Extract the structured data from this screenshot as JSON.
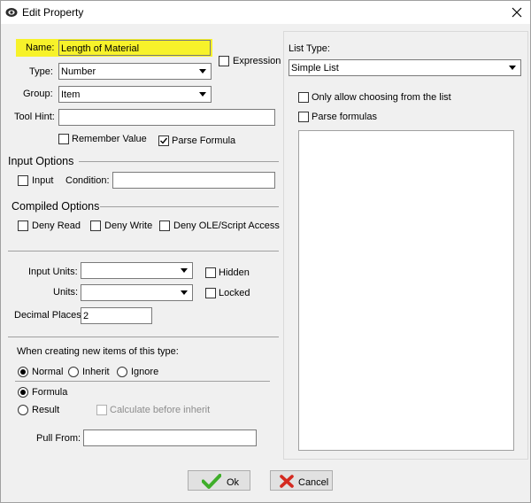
{
  "window": {
    "title": "Edit Property"
  },
  "name": {
    "label": "Name:",
    "value": "Length of Material"
  },
  "expression": {
    "label": "Expression",
    "checked": false
  },
  "type": {
    "label": "Type:",
    "value": "Number"
  },
  "group": {
    "label": "Group:",
    "value": "Item"
  },
  "tool_hint": {
    "label": "Tool Hint:",
    "value": ""
  },
  "remember_value": {
    "label": "Remember Value",
    "checked": false
  },
  "parse_formula": {
    "label": "Parse Formula",
    "checked": true
  },
  "input_options": {
    "title": "Input Options",
    "input_label": "Input",
    "condition_label": "Condition:",
    "condition_value": ""
  },
  "compiled_options": {
    "title": "Compiled Options",
    "deny_read": "Deny Read",
    "deny_write": "Deny Write",
    "deny_ole": "Deny OLE/Script Access"
  },
  "units": {
    "input_units_label": "Input Units:",
    "units_label": "Units:",
    "hidden_label": "Hidden",
    "locked_label": "Locked",
    "decimal_label": "Decimal Places:",
    "decimal_value": "2"
  },
  "new_items": {
    "title": "When creating new items of this type:",
    "normal": "Normal",
    "inherit": "Inherit",
    "ignore": "Ignore",
    "formula": "Formula",
    "result": "Result",
    "calc_before": "Calculate before inherit",
    "pull_from_label": "Pull From:",
    "selected_mode": "Normal",
    "selected_source": "Formula"
  },
  "list_type": {
    "label": "List Type:",
    "value": "Simple List",
    "only_allow": "Only allow choosing from the list",
    "parse_formulas": "Parse formulas"
  },
  "buttons": {
    "ok": "Ok",
    "cancel": "Cancel"
  },
  "colors": {
    "highlight": "#f7f22a",
    "ok_check": "#3fae2a",
    "cancel_x": "#d42a20"
  }
}
